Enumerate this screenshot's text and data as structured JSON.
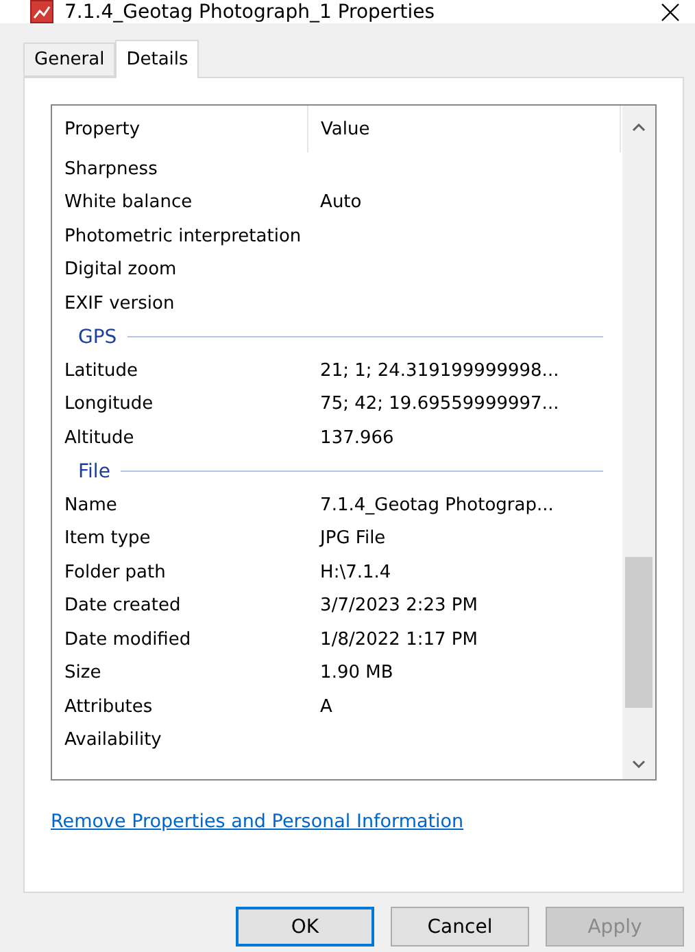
{
  "window": {
    "title": "7.1.4_Geotag Photograph_1 Properties"
  },
  "tabs": [
    {
      "label": "General",
      "selected": false
    },
    {
      "label": "Details",
      "selected": true
    }
  ],
  "table": {
    "columns": [
      "Property",
      "Value"
    ],
    "rows": [
      {
        "kind": "row",
        "property": "Sharpness",
        "value": ""
      },
      {
        "kind": "row",
        "property": "White balance",
        "value": "Auto"
      },
      {
        "kind": "row",
        "property": "Photometric interpretation",
        "value": ""
      },
      {
        "kind": "row",
        "property": "Digital zoom",
        "value": ""
      },
      {
        "kind": "row",
        "property": "EXIF version",
        "value": ""
      },
      {
        "kind": "group",
        "property": "GPS"
      },
      {
        "kind": "row",
        "property": "Latitude",
        "value": "21; 1; 24.319199999998..."
      },
      {
        "kind": "row",
        "property": "Longitude",
        "value": "75; 42; 19.69559999997..."
      },
      {
        "kind": "row",
        "property": "Altitude",
        "value": "137.966"
      },
      {
        "kind": "group",
        "property": "File"
      },
      {
        "kind": "row",
        "property": "Name",
        "value": "7.1.4_Geotag Photograp..."
      },
      {
        "kind": "row",
        "property": "Item type",
        "value": "JPG File"
      },
      {
        "kind": "row",
        "property": "Folder path",
        "value": "H:\\7.1.4"
      },
      {
        "kind": "row",
        "property": "Date created",
        "value": "3/7/2023 2:23 PM"
      },
      {
        "kind": "row",
        "property": "Date modified",
        "value": "1/8/2022 1:17 PM"
      },
      {
        "kind": "row",
        "property": "Size",
        "value": "1.90 MB"
      },
      {
        "kind": "row",
        "property": "Attributes",
        "value": "A"
      },
      {
        "kind": "row",
        "property": "Availability",
        "value": ""
      }
    ]
  },
  "link": "Remove Properties and Personal Information",
  "buttons": [
    {
      "label": "OK",
      "default": true,
      "disabled": false
    },
    {
      "label": "Cancel",
      "default": false,
      "disabled": false
    },
    {
      "label": "Apply",
      "default": false,
      "disabled": true
    }
  ]
}
